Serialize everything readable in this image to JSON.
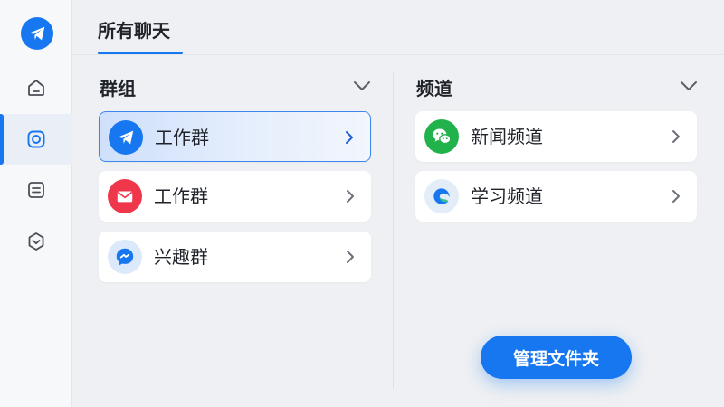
{
  "app": {
    "logo_icon": "paper-plane-icon",
    "accent": "#1677f0"
  },
  "sidebar": {
    "items": [
      {
        "icon": "home-icon",
        "active": false
      },
      {
        "icon": "chat-circle-icon",
        "active": true
      },
      {
        "icon": "document-icon",
        "active": false
      },
      {
        "icon": "check-shield-icon",
        "active": false
      }
    ]
  },
  "header": {
    "tab_label": "所有聊天"
  },
  "groups": {
    "title": "群组",
    "items": [
      {
        "label": "工作群",
        "icon": "paper-plane-icon",
        "icon_bg": "#1677f0",
        "selected": true
      },
      {
        "label": "工作群",
        "icon": "mail-icon",
        "icon_bg": "#f0364a",
        "selected": false
      },
      {
        "label": "兴趣群",
        "icon": "messenger-icon",
        "icon_bg": "#dbe9fb",
        "selected": false
      }
    ]
  },
  "channels": {
    "title": "频道",
    "items": [
      {
        "label": "新闻频道",
        "icon": "wechat-icon",
        "icon_bg": "#22b24c"
      },
      {
        "label": "学习频道",
        "icon": "edge-browser-icon",
        "icon_bg": "#e3edf8"
      }
    ]
  },
  "actions": {
    "manage_folders_label": "管理文件夹"
  }
}
